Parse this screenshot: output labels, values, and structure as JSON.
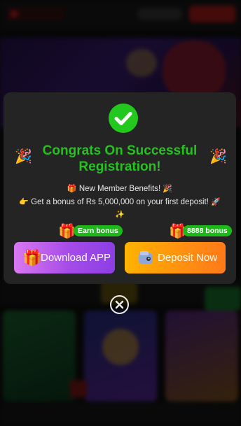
{
  "modal": {
    "title": "Congrats On Successful Registration!",
    "benefits_heading": "New Member Benefits!",
    "bonus_text": "Get a bonus of Rs 5,000,000 on your first deposit!",
    "icons": {
      "success": "checkmark-icon",
      "decoration": "party-popper-icon",
      "gift": "gift-icon",
      "pointer": "hand-pointing-icon",
      "rocket": "rocket-icon",
      "sparkles": "sparkles-icon",
      "wallet": "wallet-icon",
      "close": "close-icon"
    },
    "download": {
      "badge": "Earn bonus",
      "label": "Download APP"
    },
    "deposit": {
      "badge": "8888 bonus",
      "label": "Deposit Now"
    }
  },
  "colors": {
    "accent_green": "#25c21f",
    "modal_bg": "#242424",
    "download_gradient": [
      "#d978f0",
      "#8b3fe4"
    ],
    "deposit_gradient": [
      "#ffb300",
      "#ff7a18"
    ]
  }
}
